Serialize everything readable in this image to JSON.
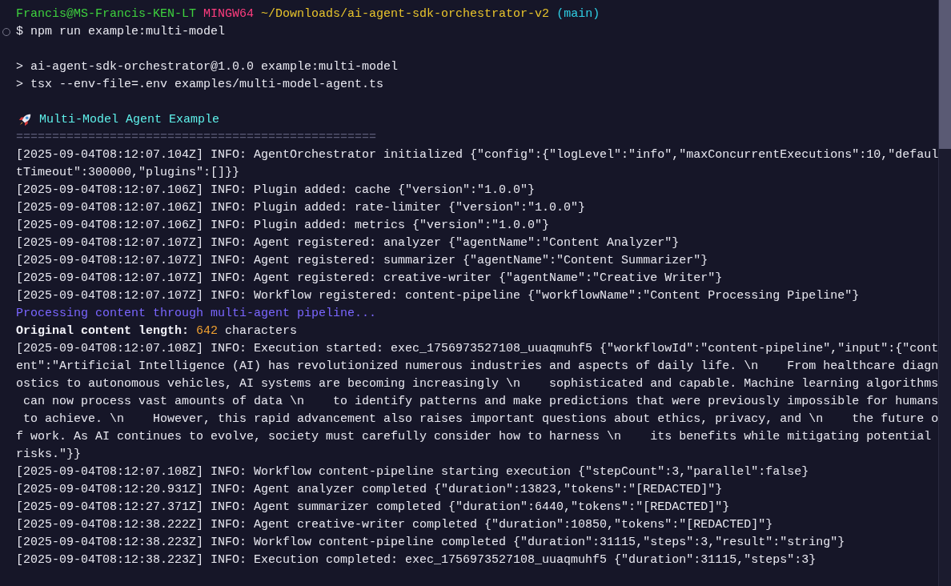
{
  "terminal": {
    "blocks": [
      {
        "lines": [
          {
            "kind": "prompt",
            "segments": [
              {
                "kind": "user",
                "text": "Francis@MS-Francis-KEN-LT"
              },
              {
                "kind": "shell",
                "text": "MINGW64"
              },
              {
                "kind": "path",
                "text": "~/Downloads/ai-agent-sdk-orchestrator-v2"
              },
              {
                "kind": "branch",
                "text": "(main)"
              }
            ]
          },
          {
            "kind": "command",
            "text": "$ npm run example:multi-model"
          }
        ]
      },
      {
        "lines": [
          {
            "kind": "output",
            "text": "> ai-agent-sdk-orchestrator@1.0.0 example:multi-model"
          },
          {
            "kind": "output",
            "text": "> tsx --env-file=.env examples/multi-model-agent.ts"
          }
        ]
      },
      {
        "lines": [
          {
            "kind": "heading",
            "text": "Multi-Model Agent Example"
          },
          {
            "kind": "divider",
            "text": "=================================================="
          },
          {
            "kind": "log",
            "text": "[2025-09-04T08:12:07.104Z] INFO: AgentOrchestrator initialized {\"config\":{\"logLevel\":\"info\",\"maxConcurrentExecutions\":10,\"defaul"
          },
          {
            "kind": "log",
            "text": "tTimeout\":300000,\"plugins\":[]}}"
          },
          {
            "kind": "log",
            "text": "[2025-09-04T08:12:07.106Z] INFO: Plugin added: cache {\"version\":\"1.0.0\"}"
          },
          {
            "kind": "log",
            "text": "[2025-09-04T08:12:07.106Z] INFO: Plugin added: rate-limiter {\"version\":\"1.0.0\"}"
          },
          {
            "kind": "log",
            "text": "[2025-09-04T08:12:07.106Z] INFO: Plugin added: metrics {\"version\":\"1.0.0\"}"
          },
          {
            "kind": "log",
            "text": "[2025-09-04T08:12:07.107Z] INFO: Agent registered: analyzer {\"agentName\":\"Content Analyzer\"}"
          },
          {
            "kind": "log",
            "text": "[2025-09-04T08:12:07.107Z] INFO: Agent registered: summarizer {\"agentName\":\"Content Summarizer\"}"
          },
          {
            "kind": "log",
            "text": "[2025-09-04T08:12:07.107Z] INFO: Agent registered: creative-writer {\"agentName\":\"Creative Writer\"}"
          },
          {
            "kind": "log",
            "text": "[2025-09-04T08:12:07.107Z] INFO: Workflow registered: content-pipeline {\"workflowName\":\"Content Processing Pipeline\"}"
          },
          {
            "kind": "info",
            "text": "Processing content through multi-agent pipeline..."
          },
          {
            "kind": "summary",
            "segments": [
              {
                "kind": "label",
                "text": "Original content length:"
              },
              {
                "kind": "value",
                "text": "642"
              },
              {
                "kind": "unit",
                "text": "characters"
              }
            ]
          },
          {
            "kind": "log",
            "text": "[2025-09-04T08:12:07.108Z] INFO: Execution started: exec_1756973527108_uuaqmuhf5 {\"workflowId\":\"content-pipeline\",\"input\":{\"cont"
          },
          {
            "kind": "log",
            "text": "ent\":\"Artificial Intelligence (AI) has revolutionized numerous industries and aspects of daily life. \\n    From healthcare diagn"
          },
          {
            "kind": "log",
            "text": "ostics to autonomous vehicles, AI systems are becoming increasingly \\n    sophisticated and capable. Machine learning algorithms"
          },
          {
            "kind": "log",
            "text": " can now process vast amounts of data \\n    to identify patterns and make predictions that were previously impossible for humans"
          },
          {
            "kind": "log",
            "text": " to achieve. \\n    However, this rapid advancement also raises important questions about ethics, privacy, and \\n    the future o"
          },
          {
            "kind": "log",
            "text": "f work. As AI continues to evolve, society must carefully consider how to harness \\n    its benefits while mitigating potential"
          },
          {
            "kind": "log",
            "text": "risks.\"}}"
          },
          {
            "kind": "log",
            "text": "[2025-09-04T08:12:07.108Z] INFO: Workflow content-pipeline starting execution {\"stepCount\":3,\"parallel\":false}"
          },
          {
            "kind": "log",
            "text": "[2025-09-04T08:12:20.931Z] INFO: Agent analyzer completed {\"duration\":13823,\"tokens\":\"[REDACTED]\"}"
          },
          {
            "kind": "log",
            "text": "[2025-09-04T08:12:27.371Z] INFO: Agent summarizer completed {\"duration\":6440,\"tokens\":\"[REDACTED]\"}"
          },
          {
            "kind": "log",
            "text": "[2025-09-04T08:12:38.222Z] INFO: Agent creative-writer completed {\"duration\":10850,\"tokens\":\"[REDACTED]\"}"
          },
          {
            "kind": "log",
            "text": "[2025-09-04T08:12:38.223Z] INFO: Workflow content-pipeline completed {\"duration\":31115,\"steps\":3,\"result\":\"string\"}"
          },
          {
            "kind": "log",
            "text": "[2025-09-04T08:12:38.223Z] INFO: Execution completed: exec_1756973527108_uuaqmuhf5 {\"duration\":31115,\"steps\":3}"
          }
        ]
      }
    ]
  }
}
